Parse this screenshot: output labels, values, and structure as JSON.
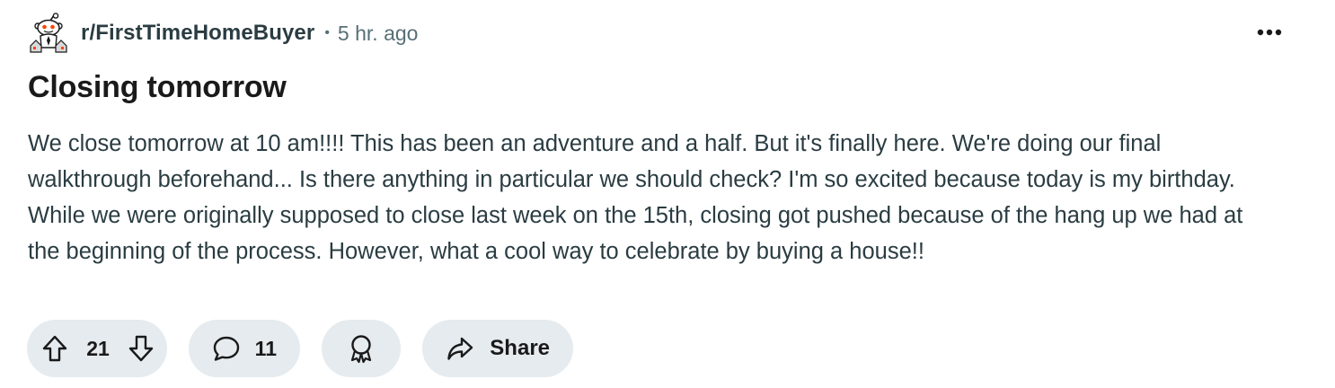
{
  "header": {
    "subreddit": "r/FirstTimeHomeBuyer",
    "separator": "•",
    "time_ago": "5 hr. ago",
    "more_icon": "more-horizontal-icon",
    "avatar_icon": "snoo-house-avatar"
  },
  "post": {
    "title": "Closing tomorrow",
    "body": "We close tomorrow at 10 am!!!! This has been an adventure and a half. But it's finally here. We're doing our final walkthrough beforehand... Is there anything in particular we should check? I'm so excited because today is my birthday. While we were originally supposed to close last week on the 15th, closing got pushed because of the hang up we had at the beginning of the process. However, what a cool way to celebrate by buying a house!!"
  },
  "actions": {
    "vote_count": "21",
    "comment_count": "11",
    "share_label": "Share",
    "icons": {
      "upvote": "arrow-up-icon",
      "downvote": "arrow-down-icon",
      "comment": "comment-bubble-icon",
      "award": "award-icon",
      "share": "share-arrow-icon"
    }
  },
  "colors": {
    "pill_background": "#e5ebee",
    "meta_gray": "#576f76",
    "text_dark": "#1a1a1b",
    "snoo_orange": "#ff4500"
  }
}
